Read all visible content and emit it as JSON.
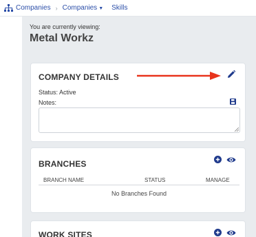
{
  "breadcrumb": {
    "item1": "Companies",
    "item2": "Companies",
    "item3": "Skills"
  },
  "header": {
    "viewing_label": "You are currently viewing:",
    "company_name": "Metal Workz"
  },
  "company_details": {
    "title": "COMPANY DETAILS",
    "status": "Status: Active",
    "notes_label": "Notes:",
    "notes_value": ""
  },
  "branches": {
    "title": "BRANCHES",
    "columns": [
      "BRANCH NAME",
      "STATUS",
      "MANAGE"
    ],
    "empty_text": "No Branches Found"
  },
  "work_sites": {
    "title": "WORK SITES"
  },
  "colors": {
    "link": "#2b4ea8",
    "icon": "#1f3a8c",
    "arrow": "#e8341c"
  },
  "icons": [
    "sitemap-icon",
    "pencil-icon",
    "save-icon",
    "plus-icon",
    "eye-icon",
    "annotation-arrow"
  ]
}
